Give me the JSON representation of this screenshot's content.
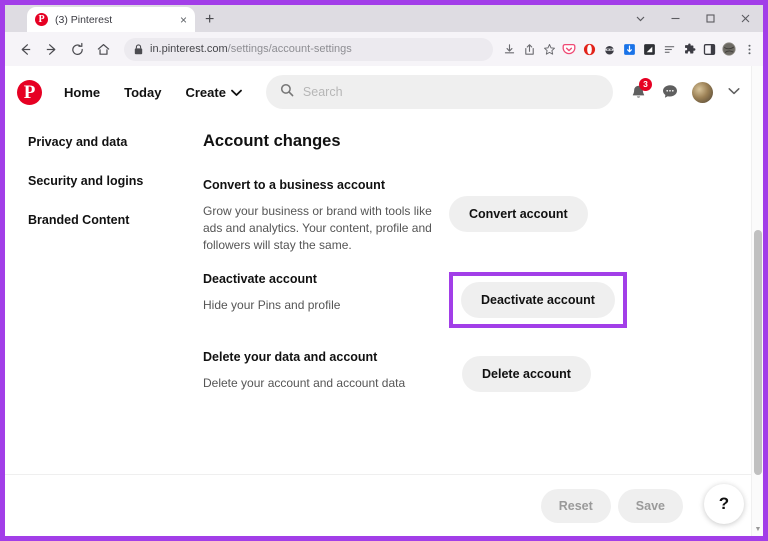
{
  "browser": {
    "tab": {
      "title": "(3) Pinterest",
      "favicon_letter": "P",
      "close_label": "×"
    },
    "newtab_label": "+",
    "window_controls": {
      "chevron": "chevron-down",
      "minimize": "minimize",
      "maximize": "maximize",
      "close": "close"
    },
    "nav": {
      "back": "back-arrow",
      "forward": "forward-arrow",
      "reload": "reload",
      "home": "home"
    },
    "omnibox": {
      "url_domain": "in.pinterest.com",
      "url_path": "/settings/account-settings",
      "lock": "site-secure"
    },
    "toolbar_icons": [
      {
        "name": "downloads-icon",
        "color": "#5f6368"
      },
      {
        "name": "share-icon",
        "color": "#5f6368"
      },
      {
        "name": "bookmark-star-icon",
        "color": "#5f6368"
      },
      {
        "name": "pocket-extension-icon",
        "color": "#ef4a75"
      },
      {
        "name": "opera-extension-icon",
        "color": "#e2231a"
      },
      {
        "name": "ninja-extension-icon",
        "color": "#3c3c44"
      },
      {
        "name": "unbounce-extension-icon",
        "color": "#1a73e8"
      },
      {
        "name": "dark-reader-extension-icon",
        "color": "#2f3136"
      },
      {
        "name": "reading-list-icon",
        "color": "#5f6368"
      },
      {
        "name": "extensions-puzzle-icon",
        "color": "#3c3c44"
      },
      {
        "name": "sidebar-toggle-icon",
        "color": "#3c3c44"
      },
      {
        "name": "profile-avatar-icon",
        "color": "#6d6a64"
      },
      {
        "name": "browser-menu-icon",
        "color": "#5f6368"
      }
    ]
  },
  "pinterest": {
    "logo": "pinterest-logo",
    "nav": [
      {
        "label": "Home",
        "name": "nav-home"
      },
      {
        "label": "Today",
        "name": "nav-today"
      },
      {
        "label": "Create",
        "name": "nav-create",
        "has_chevron": true
      }
    ],
    "search": {
      "placeholder": "Search",
      "value": "",
      "icon": "search-icon"
    },
    "header_right": {
      "notifications_icon": "bell-icon",
      "notifications_count": "3",
      "messages_icon": "chat-bubble-icon",
      "avatar": "user-avatar",
      "account_chevron": "chevron-down-icon"
    }
  },
  "sidebar": {
    "items": [
      {
        "label": "Privacy and data",
        "name": "sidebar-item-privacy-and-data"
      },
      {
        "label": "Security and logins",
        "name": "sidebar-item-security-and-logins"
      },
      {
        "label": "Branded Content",
        "name": "sidebar-item-branded-content"
      }
    ]
  },
  "main": {
    "title": "Account changes",
    "sections": [
      {
        "heading": "Convert to a business account",
        "description": "Grow your business or brand with tools like ads and analytics. Your content, profile and followers will stay the same.",
        "button": "Convert account",
        "highlighted": false
      },
      {
        "heading": "Deactivate account",
        "description": "Hide your Pins and profile",
        "button": "Deactivate account",
        "highlighted": true
      },
      {
        "heading": "Delete your data and account",
        "description": "Delete your account and account data",
        "button": "Delete account",
        "highlighted": false
      }
    ]
  },
  "footer": {
    "reset_label": "Reset",
    "save_label": "Save",
    "help_label": "?"
  },
  "colors": {
    "annotation_purple": "#a23ee8",
    "pinterest_red": "#e60023",
    "button_grey": "#efefef"
  }
}
